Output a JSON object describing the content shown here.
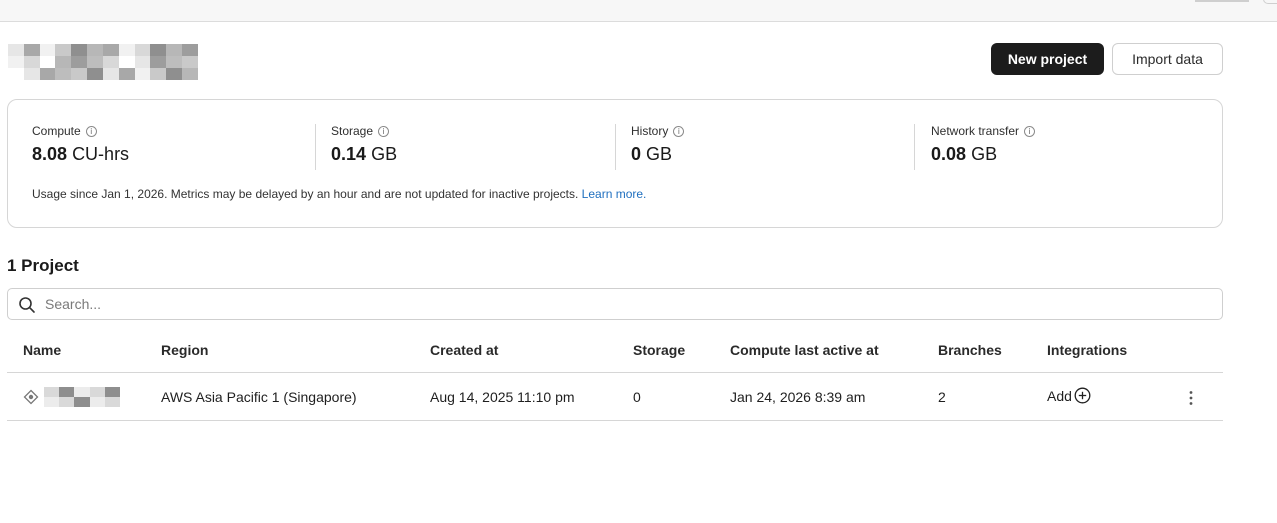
{
  "header": {
    "org_name_pixelated": true,
    "new_project_label": "New project",
    "import_data_label": "Import data"
  },
  "usage": {
    "metrics": [
      {
        "label": "Compute",
        "value": "8.08",
        "unit": "CU-hrs"
      },
      {
        "label": "Storage",
        "value": "0.14",
        "unit": "GB"
      },
      {
        "label": "History",
        "value": "0",
        "unit": "GB"
      },
      {
        "label": "Network transfer",
        "value": "0.08",
        "unit": "GB"
      }
    ],
    "note": "Usage since Jan 1, 2026. Metrics may be delayed by an hour and are not updated for inactive projects.",
    "learn_more": "Learn more."
  },
  "projects": {
    "count_title": "1 Project",
    "search_placeholder": "Search...",
    "columns": [
      "Name",
      "Region",
      "Created at",
      "Storage",
      "Compute last active at",
      "Branches",
      "Integrations"
    ],
    "rows": [
      {
        "name_pixelated": true,
        "region": "AWS Asia Pacific 1 (Singapore)",
        "created_at": "Aug 14, 2025 11:10 pm",
        "storage": "0",
        "compute_last_active": "Jan 24, 2026 8:39 am",
        "branches": "2",
        "integrations_label": "Add"
      }
    ]
  },
  "icons": {
    "info": "info-icon",
    "search": "search-icon",
    "project": "project-node-icon",
    "add": "plus-circle-icon",
    "menu": "kebab-menu-icon"
  },
  "colors": {
    "primary_button": "#1c1c1c",
    "link": "#1f6fbf",
    "border": "#d6d6d6"
  }
}
